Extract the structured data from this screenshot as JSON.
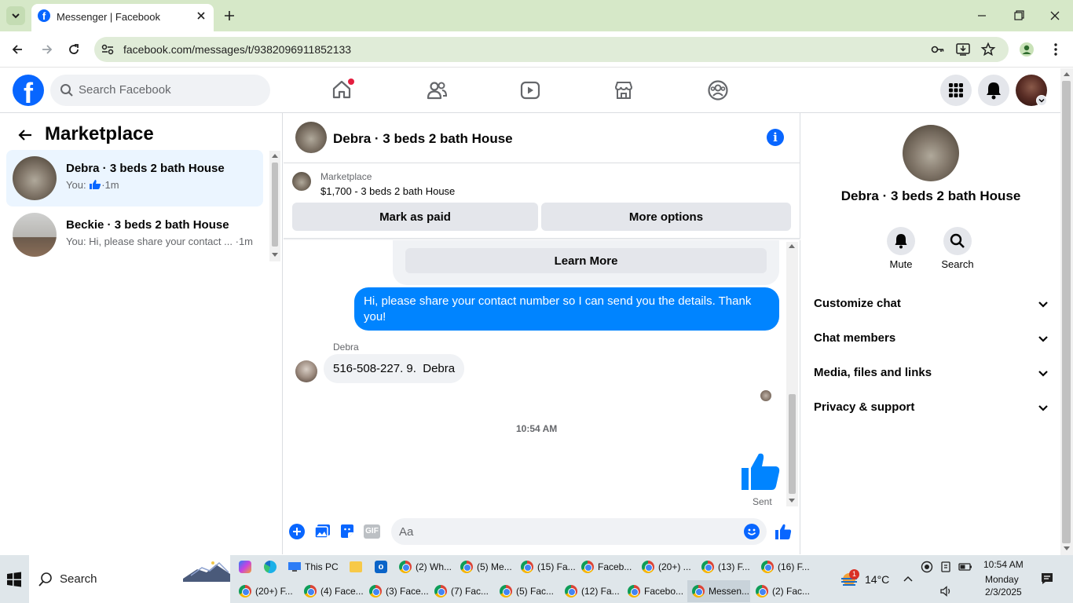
{
  "browser": {
    "tab_title": "Messenger | Facebook",
    "url": "facebook.com/messages/t/9382096911852133"
  },
  "fb_header": {
    "search_placeholder": "Search Facebook"
  },
  "left_panel": {
    "title": "Marketplace",
    "conversations": [
      {
        "name": "Debra · 3 beds 2 bath House",
        "preview_prefix": "You:",
        "time": "1m"
      },
      {
        "name": "Beckie · 3 beds 2 bath House",
        "preview": "You: Hi, please share your contact ...",
        "time": "·1m"
      }
    ]
  },
  "chat": {
    "header_name": "Debra · 3 beds 2 bath House",
    "listing_source": "Marketplace",
    "listing_title": "$1,700 - 3 beds 2 bath House",
    "mark_paid_label": "Mark as paid",
    "more_options_label": "More options",
    "learn_more_label": "Learn More",
    "outgoing_message": "Hi, please share your contact number so I can send you the details. Thank you!",
    "incoming_sender": "Debra",
    "incoming_message": "516-508-227. 9.  Debra",
    "timestamp": "10:54 AM",
    "sent_status": "Sent",
    "composer_placeholder": "Aa"
  },
  "right_panel": {
    "name": "Debra · 3 beds 2 bath House",
    "mute_label": "Mute",
    "search_label": "Search",
    "sections": [
      "Customize chat",
      "Chat members",
      "Media, files and links",
      "Privacy & support"
    ]
  },
  "taskbar": {
    "search_label": "Search",
    "this_pc_label": "This PC",
    "top_row": [
      "(2) Wh...",
      "(5) Me...",
      "(15) Fa...",
      "Faceb...",
      "(20+) ...",
      "(13) F...",
      "(16) F..."
    ],
    "bottom_row": [
      "(20+) F...",
      "(4) Face...",
      "(3) Face...",
      "(7) Fac...",
      "(5) Fac...",
      "(12) Fa...",
      "Facebo...",
      "Messen...",
      "(2) Fac..."
    ],
    "weather_badge": "1",
    "temperature": "14°C",
    "time": "10:54 AM",
    "day": "Monday",
    "date": "2/3/2025"
  },
  "colors": {
    "fb_blue": "#0866ff",
    "messenger_blue": "#0084ff",
    "tab_strip": "#d6e8c8"
  }
}
